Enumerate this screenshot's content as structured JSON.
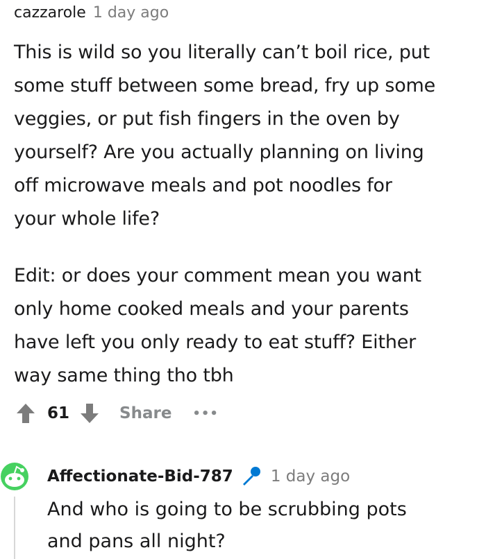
{
  "comment1": {
    "author": "cazzarole",
    "time": "1 day ago",
    "lines_para1": [
      "This is wild so you literally can’t boil rice, put",
      "some stuff between some bread, fry up some",
      "veggies, or put fish fingers in the oven by",
      "yourself? Are you actually planning on living",
      "off microwave meals and pot noodles for",
      "your whole life?"
    ],
    "lines_para2": [
      "Edit: or does your comment mean you want",
      "only home cooked meals and your parents",
      "have left you only ready to eat stuff? Either",
      "way same thing tho tbh"
    ],
    "score": "61",
    "share_label": "Share",
    "more_label": "•••"
  },
  "comment2": {
    "author": "Affectionate-Bid-787",
    "time": "1 day ago",
    "lines": [
      "And who is going to be scrubbing pots",
      "and pans all night?"
    ]
  },
  "colors": {
    "avatar_green": "#46d160",
    "mic_blue": "#0079d3",
    "muted": "#878a8c"
  },
  "icons": {
    "upvote": "arrow-up-icon",
    "downvote": "arrow-down-icon",
    "avatar": "snoo-avatar-icon",
    "flair": "microphone-icon"
  }
}
